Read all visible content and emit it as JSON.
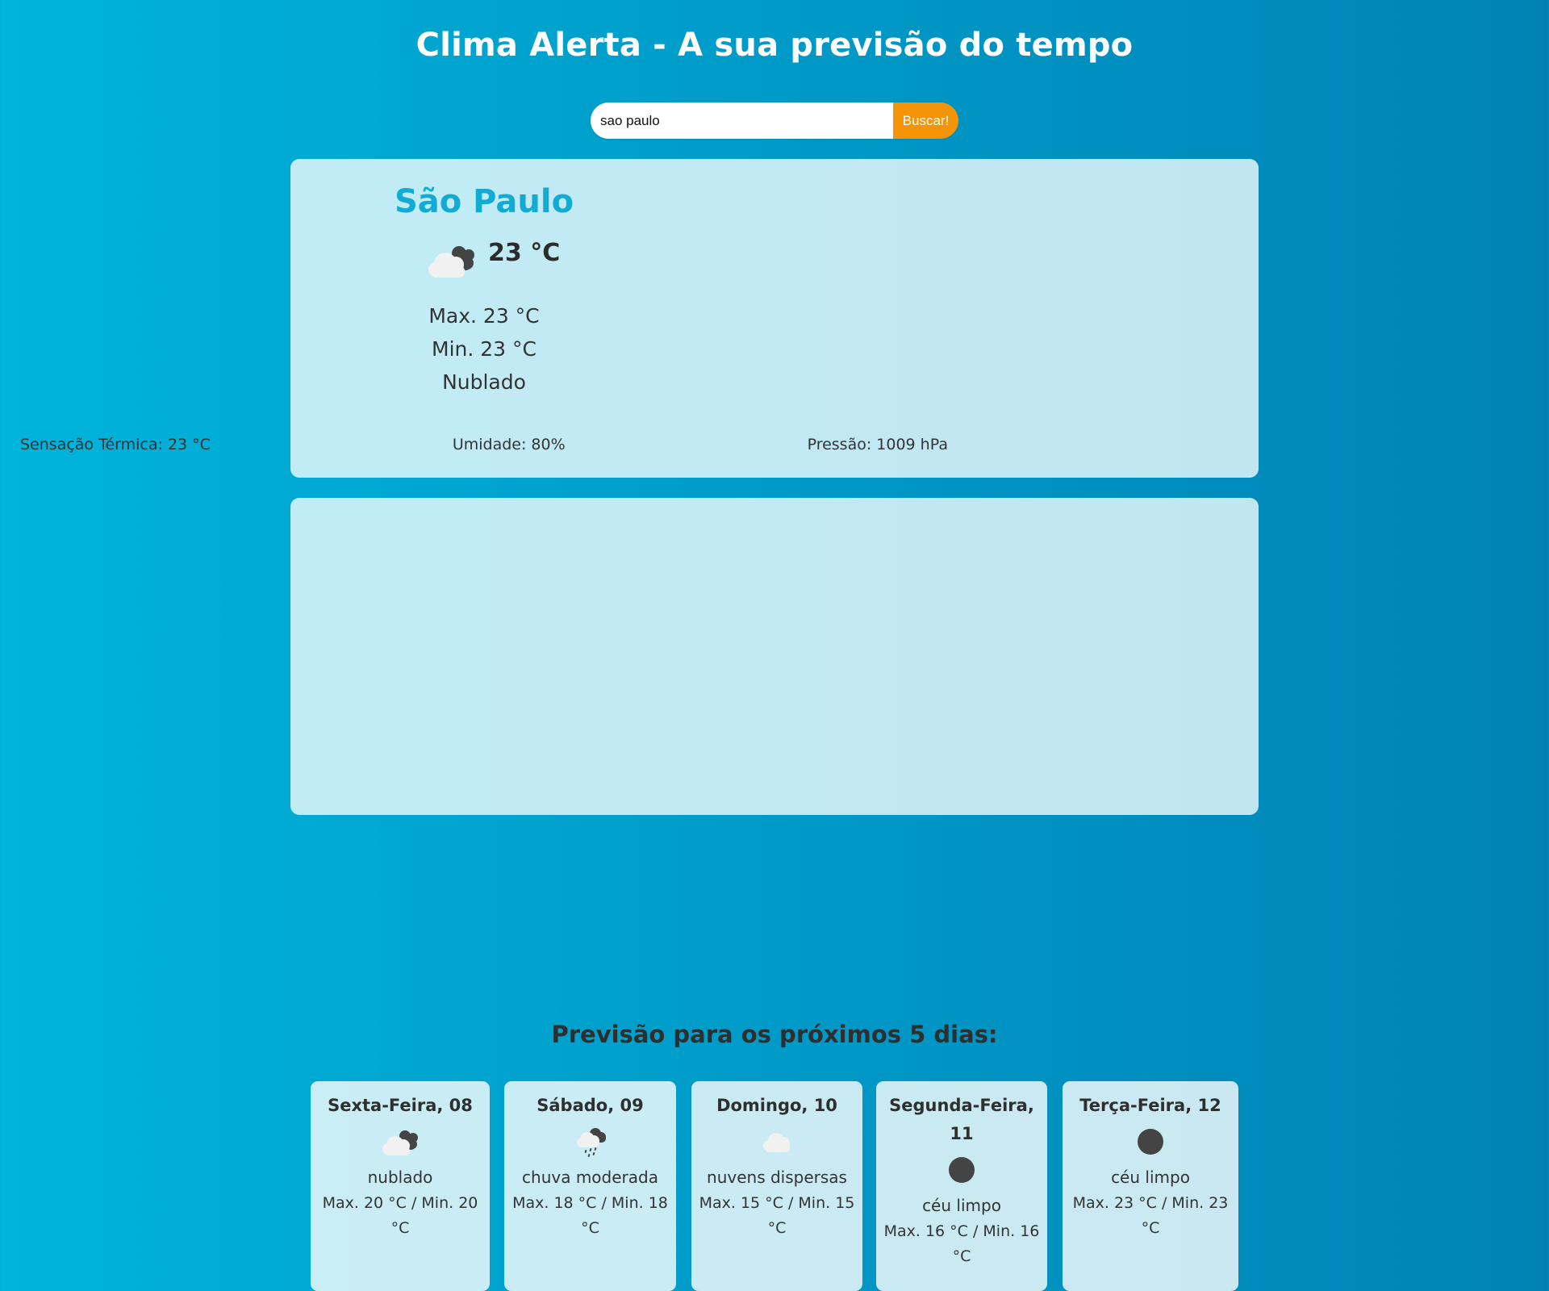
{
  "header": {
    "title": "Clima Alerta - A sua previsão do tempo"
  },
  "search": {
    "value": "sao paulo",
    "button_label": "Buscar!"
  },
  "current": {
    "city": "São Paulo",
    "icon": "cloudy-icon",
    "temperature": "23 °C",
    "max": "Max. 23 °C",
    "min": "Min. 23 °C",
    "description": "Nublado",
    "feels_like": "Sensação Térmica: 23 °C",
    "humidity": "Umidade: 80%",
    "pressure": "Pressão: 1009 hPa"
  },
  "forecast": {
    "title": "Previsão para os próximos 5 dias:",
    "days": [
      {
        "name": "Sexta-Feira, 08",
        "icon": "cloudy-icon",
        "description": "nublado",
        "range": "Max. 20 °C / Min. 20 °C"
      },
      {
        "name": "Sábado, 09",
        "icon": "rain-icon",
        "description": "chuva moderada",
        "range": "Max. 18 °C / Min. 18 °C"
      },
      {
        "name": "Domingo, 10",
        "icon": "scattered-clouds-icon",
        "description": "nuvens dispersas",
        "range": "Max. 15 °C / Min. 15 °C"
      },
      {
        "name": "Segunda-Feira, 11",
        "icon": "clear-sky-icon",
        "description": "céu limpo",
        "range": "Max. 16 °C / Min. 16 °C"
      },
      {
        "name": "Terça-Feira, 12",
        "icon": "clear-sky-icon",
        "description": "céu limpo",
        "range": "Max. 23 °C / Min. 23 °C"
      }
    ]
  },
  "colors": {
    "background_start": "#00b4dc",
    "background_end": "#0083b4",
    "accent": "#11abd3",
    "button": "#f59408",
    "dark_icon": "#444444",
    "cloud": "#f1f1f1"
  }
}
